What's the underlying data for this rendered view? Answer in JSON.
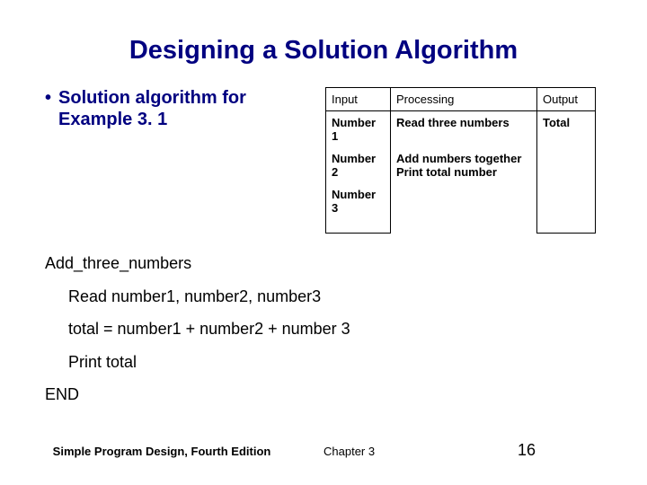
{
  "title": "Designing a Solution Algorithm",
  "bullet": {
    "text": "Solution algorithm for Example 3. 1"
  },
  "table": {
    "headers": {
      "c1": "Input",
      "c2": "Processing",
      "c3": "Output"
    },
    "rows": [
      {
        "c1": "Number 1",
        "c2": "Read three numbers",
        "c3": "Total"
      },
      {
        "c1": "Number 2",
        "c2": "Add numbers together",
        "c3": ""
      },
      {
        "c1": "Number 3",
        "c2": "Print total number",
        "c3": ""
      }
    ]
  },
  "algo": {
    "l1": "Add_three_numbers",
    "l2": "Read number1, number2, number3",
    "l3": "total = number1 + number2 + number 3",
    "l4": "Print total",
    "l5": "END"
  },
  "footer": {
    "left": "Simple Program Design, Fourth Edition",
    "center": "Chapter 3",
    "right": "16"
  }
}
